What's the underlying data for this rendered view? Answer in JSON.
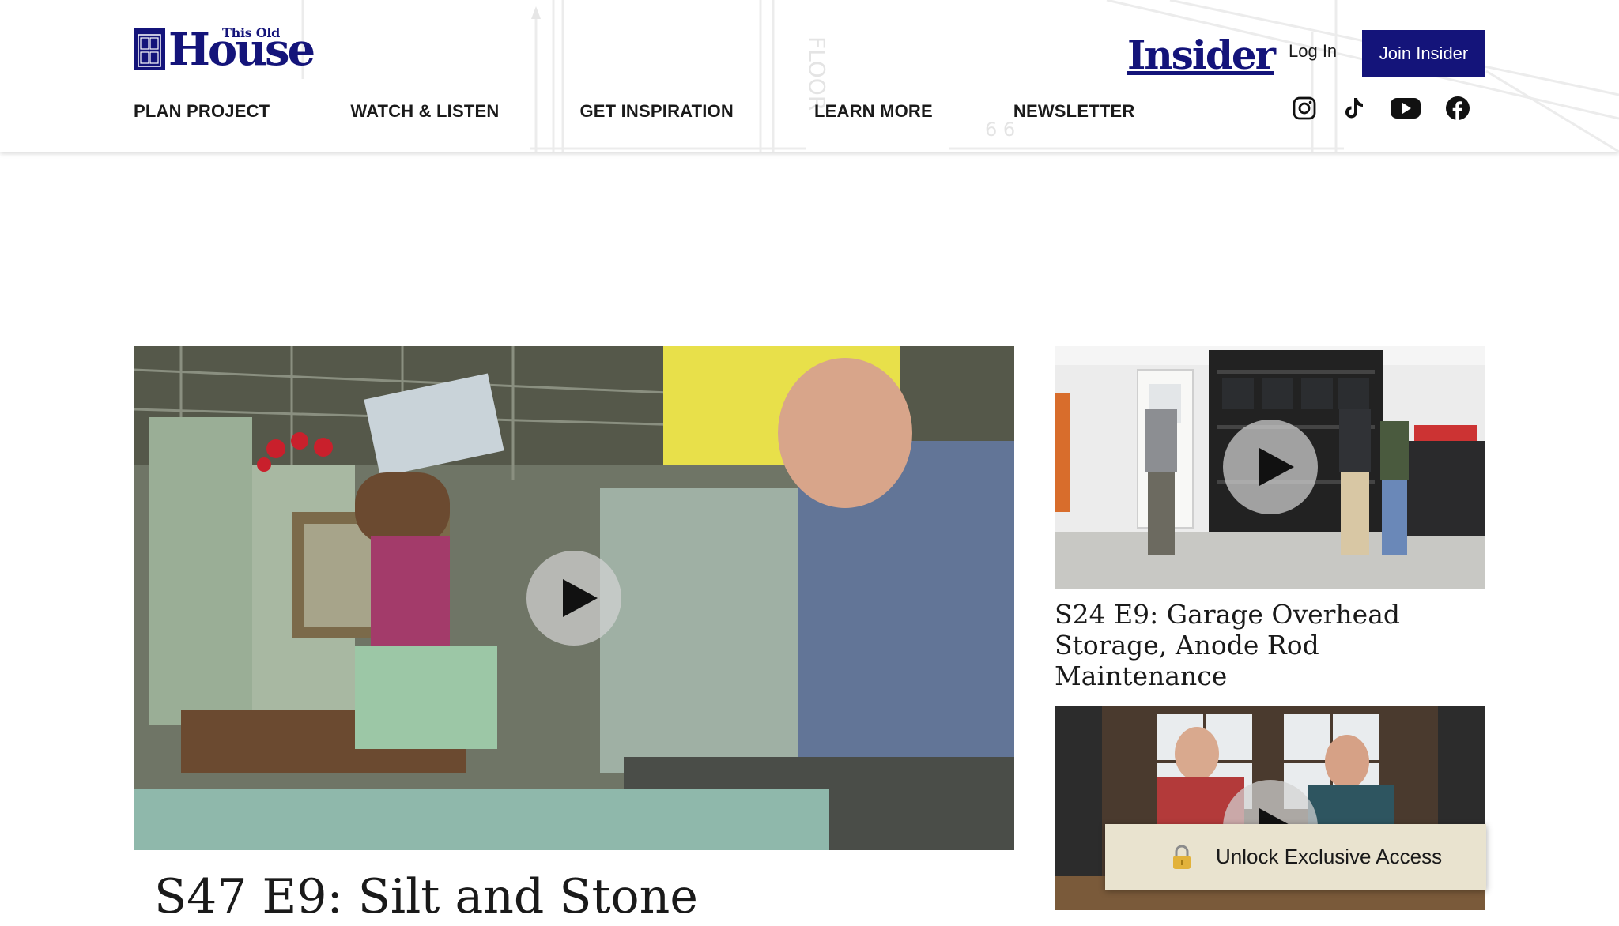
{
  "brand": {
    "logo_small": "This Old",
    "logo_big": "House",
    "insider_wordmark": "Insider",
    "primary_color": "#14147a"
  },
  "header": {
    "login_label": "Log In",
    "join_label": "Join Insider"
  },
  "nav": {
    "items": [
      {
        "label": "PLAN PROJECT"
      },
      {
        "label": "WATCH & LISTEN"
      },
      {
        "label": "GET INSPIRATION"
      },
      {
        "label": "LEARN MORE"
      },
      {
        "label": "NEWSLETTER"
      }
    ]
  },
  "socials": [
    "instagram-icon",
    "tiktok-icon",
    "youtube-icon",
    "facebook-icon"
  ],
  "videos": {
    "featured": {
      "title": "S47 E9: Silt and Stone"
    },
    "side": [
      {
        "title": "S24 E9: Garage Overhead Storage, Anode Rod Maintenance"
      },
      {
        "title": ""
      }
    ]
  },
  "unlock_banner": {
    "label": "Unlock Exclusive Access",
    "background": "#e9e3cf"
  }
}
